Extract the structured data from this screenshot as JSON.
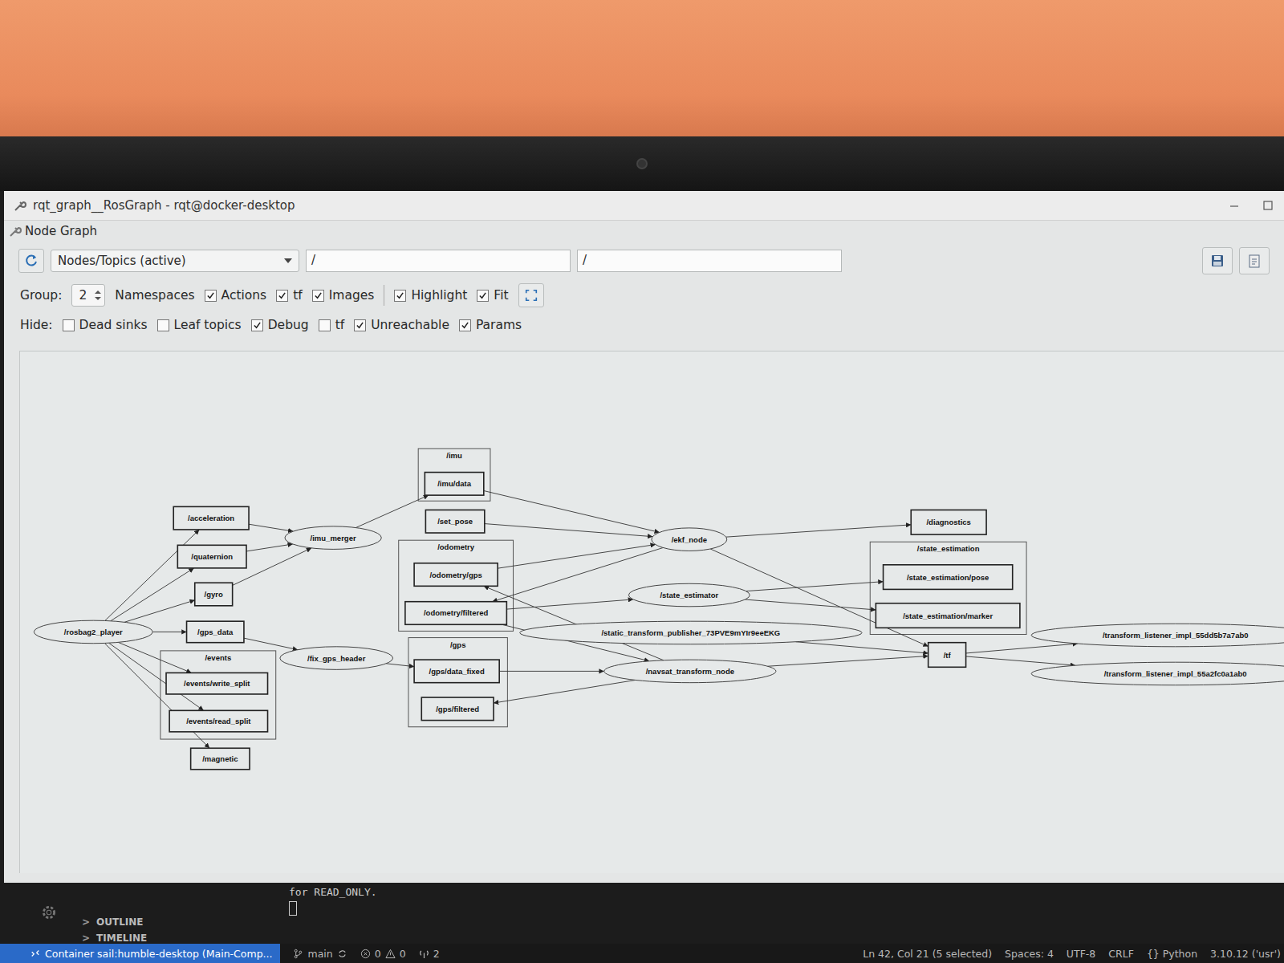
{
  "window": {
    "title": "rqt_graph__RosGraph - rqt@docker-desktop"
  },
  "plugin": {
    "title": "Node Graph"
  },
  "toolbar": {
    "mode": "Nodes/Topics (active)",
    "filters": [
      "/",
      "/"
    ],
    "group_label": "Group:",
    "group_value": "2",
    "namespaces_label": "Namespaces",
    "options": [
      {
        "label": "Actions",
        "checked": true
      },
      {
        "label": "tf",
        "checked": true
      },
      {
        "label": "Images",
        "checked": true
      }
    ],
    "view_options": [
      {
        "label": "Highlight",
        "checked": true
      },
      {
        "label": "Fit",
        "checked": true
      }
    ],
    "hide_label": "Hide:",
    "hide": [
      {
        "label": "Dead sinks",
        "checked": false
      },
      {
        "label": "Leaf topics",
        "checked": false
      },
      {
        "label": "Debug",
        "checked": true
      },
      {
        "label": "tf",
        "checked": false
      },
      {
        "label": "Unreachable",
        "checked": true
      },
      {
        "label": "Params",
        "checked": true
      }
    ]
  },
  "graph": {
    "nodes": [
      {
        "label": "/rosbag2_player"
      },
      {
        "label": "/imu_merger"
      },
      {
        "label": "/fix_gps_header"
      },
      {
        "label": "/ekf_node"
      },
      {
        "label": "/state_estimator"
      },
      {
        "label": "/static_transform_publisher_73PVE9mYIr9eeEKG"
      },
      {
        "label": "/navsat_transform_node"
      },
      {
        "label": "/transform_listener_impl_55dd5b7a7ab0"
      },
      {
        "label": "/transform_listener_impl_55a2fc0a1ab0"
      }
    ],
    "groups": [
      {
        "label": "/imu"
      },
      {
        "label": "/odometry"
      },
      {
        "label": "/gps"
      },
      {
        "label": "/events"
      },
      {
        "label": "/state_estimation"
      }
    ],
    "topics": [
      {
        "label": "/acceleration"
      },
      {
        "label": "/quaternion"
      },
      {
        "label": "/gyro"
      },
      {
        "label": "/gps_data"
      },
      {
        "label": "/events/write_split"
      },
      {
        "label": "/events/read_split"
      },
      {
        "label": "/magnetic"
      },
      {
        "label": "/imu/data"
      },
      {
        "label": "/set_pose"
      },
      {
        "label": "/odometry/gps"
      },
      {
        "label": "/odometry/filtered"
      },
      {
        "label": "/gps/data_fixed"
      },
      {
        "label": "/gps/filtered"
      },
      {
        "label": "/diagnostics"
      },
      {
        "label": "/state_estimation/pose"
      },
      {
        "label": "/state_estimation/marker"
      },
      {
        "label": "/tf"
      }
    ],
    "edges": [
      {
        "from": "/rosbag2_player",
        "to": "/acceleration"
      },
      {
        "from": "/rosbag2_player",
        "to": "/quaternion"
      },
      {
        "from": "/rosbag2_player",
        "to": "/gyro"
      },
      {
        "from": "/rosbag2_player",
        "to": "/gps_data"
      },
      {
        "from": "/rosbag2_player",
        "to": "/events/write_split"
      },
      {
        "from": "/rosbag2_player",
        "to": "/events/read_split"
      },
      {
        "from": "/rosbag2_player",
        "to": "/magnetic"
      },
      {
        "from": "/acceleration",
        "to": "/imu_merger"
      },
      {
        "from": "/quaternion",
        "to": "/imu_merger"
      },
      {
        "from": "/gyro",
        "to": "/imu_merger"
      },
      {
        "from": "/imu_merger",
        "to": "/imu/data"
      },
      {
        "from": "/gps_data",
        "to": "/fix_gps_header"
      },
      {
        "from": "/fix_gps_header",
        "to": "/gps/data_fixed"
      },
      {
        "from": "/imu/data",
        "to": "/ekf_node"
      },
      {
        "from": "/set_pose",
        "to": "/ekf_node"
      },
      {
        "from": "/odometry/gps",
        "to": "/ekf_node"
      },
      {
        "from": "/ekf_node",
        "to": "/odometry/filtered"
      },
      {
        "from": "/ekf_node",
        "to": "/diagnostics"
      },
      {
        "from": "/ekf_node",
        "to": "/tf"
      },
      {
        "from": "/odometry/filtered",
        "to": "/state_estimator"
      },
      {
        "from": "/odometry/filtered",
        "to": "/navsat_transform_node"
      },
      {
        "from": "/gps/data_fixed",
        "to": "/navsat_transform_node"
      },
      {
        "from": "/navsat_transform_node",
        "to": "/odometry/gps"
      },
      {
        "from": "/navsat_transform_node",
        "to": "/gps/filtered"
      },
      {
        "from": "/state_estimator",
        "to": "/state_estimation/pose"
      },
      {
        "from": "/state_estimator",
        "to": "/state_estimation/marker"
      },
      {
        "from": "/static_transform_publisher_73PVE9mYIr9eeEKG",
        "to": "/tf"
      },
      {
        "from": "/navsat_transform_node",
        "to": "/tf"
      },
      {
        "from": "/tf",
        "to": "/transform_listener_impl_55dd5b7a7ab0"
      },
      {
        "from": "/tf",
        "to": "/transform_listener_impl_55a2fc0a1ab0"
      }
    ]
  },
  "vscode": {
    "sections": [
      {
        "toggle": ">",
        "label": "OUTLINE",
        "expanded": false
      },
      {
        "toggle": ">",
        "label": "TIMELINE",
        "expanded": false
      }
    ],
    "terminal_line": "for READ_ONLY.",
    "status": {
      "remote": "Container sail:humble-desktop (Main-Comp...",
      "branch": "main",
      "errors": "0",
      "warnings": "0",
      "ports": "2",
      "right": [
        "Ln 42, Col 21 (5 selected)",
        "Spaces: 4",
        "UTF-8",
        "CRLF",
        "{} Python",
        "3.10.12 ('usr')"
      ]
    }
  }
}
